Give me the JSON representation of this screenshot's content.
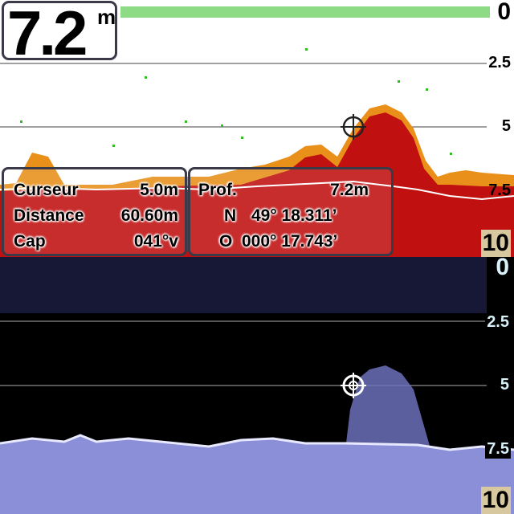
{
  "depth_display": {
    "value": "7.2",
    "unit": "m"
  },
  "cursor_info": {
    "cursor_label": "Curseur",
    "cursor_value": "5.0m",
    "distance_label": "Distance",
    "distance_value": "60.60m",
    "heading_label": "Cap",
    "heading_value": "041°v"
  },
  "position_info": {
    "depth_label": "Prof.",
    "depth_value": "7.2m",
    "lat_prefix": "N",
    "lat_value": "49° 18.311’",
    "lon_prefix": "O",
    "lon_value": "000° 17.743’"
  },
  "depth_scale_top": [
    "0",
    "2.5",
    "5",
    "7.5",
    "10"
  ],
  "depth_scale_bottom": [
    "0",
    "2.5",
    "5",
    "7.5",
    "10"
  ],
  "colors": {
    "top_background": "#ffffff",
    "bottom_background": "#000000",
    "sonar_red": "#c00000",
    "sonar_orange": "#e07010",
    "sonar_green": "#30c020",
    "side_scan_blue": "#8a8fd8",
    "box_border": "#3a3a48"
  },
  "icons": {
    "cursor": "crosshair-target-icon"
  }
}
